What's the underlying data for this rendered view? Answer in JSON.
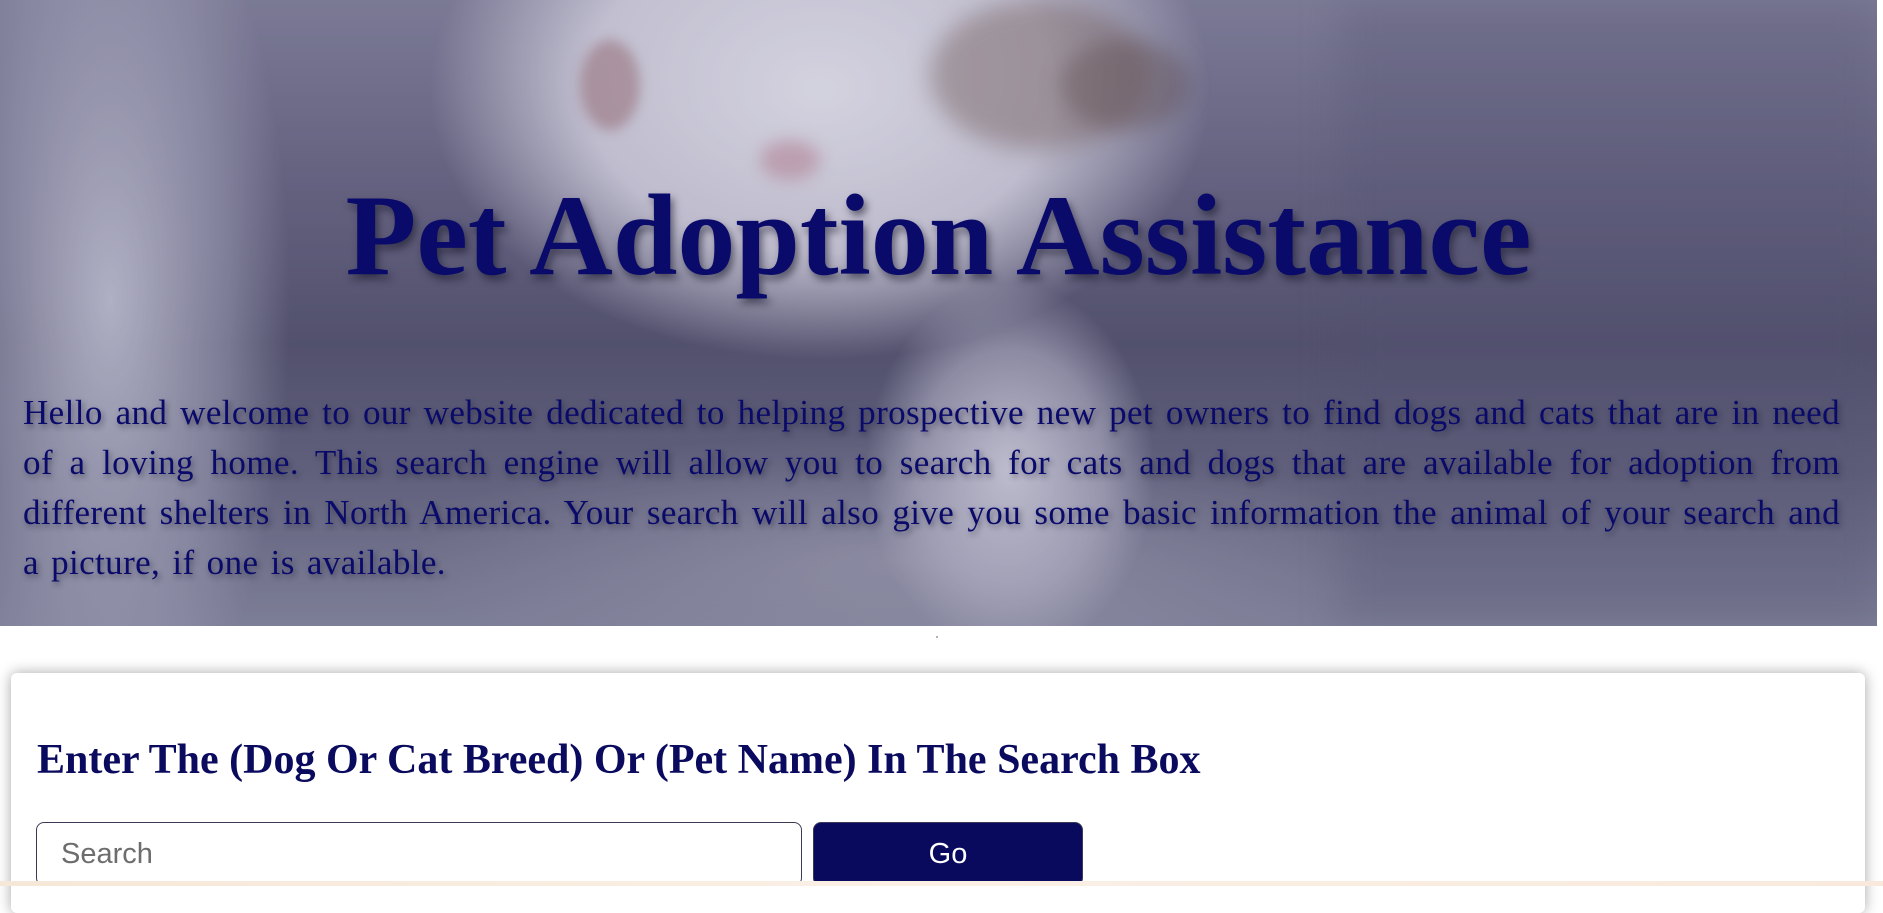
{
  "hero": {
    "title": "Pet Adoption Assistance",
    "intro": "Hello and welcome to our website dedicated to helping prospective new pet owners to find dogs and cats that are in need of a loving home. This search engine will allow you to search for cats and dogs that are available for adoption from different shelters in North America. Your search will also give you some basic information the animal of your search and a picture, if one is available.",
    "title_color": "#0a0a6b"
  },
  "search": {
    "heading": "Enter The (Dog Or Cat Breed) Or (Pet Name) In The Search Box",
    "placeholder": "Search",
    "value": "",
    "button_label": "Go",
    "button_color": "#09095e"
  }
}
